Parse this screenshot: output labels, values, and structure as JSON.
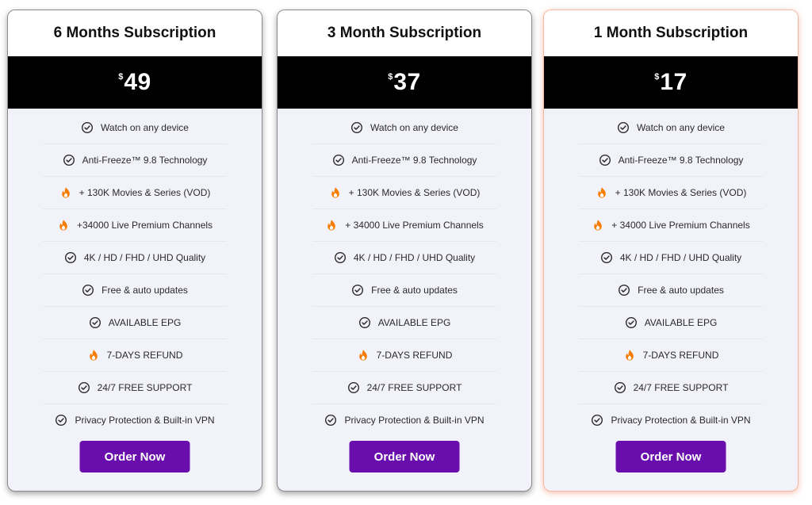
{
  "plans": [
    {
      "title": "6 Months Subscription",
      "currency": "$",
      "price": "49",
      "features": [
        {
          "icon": "check-circle-icon",
          "text": "Watch on any device"
        },
        {
          "icon": "check-circle-icon",
          "text": "Anti-Freeze™ 9.8 Technology"
        },
        {
          "icon": "fire-icon",
          "text": "+ 130K Movies & Series (VOD)"
        },
        {
          "icon": "fire-icon",
          "text": "+34000 Live Premium Channels"
        },
        {
          "icon": "check-circle-icon",
          "text": "4K / HD / FHD / UHD Quality"
        },
        {
          "icon": "check-circle-icon",
          "text": "Free & auto updates"
        },
        {
          "icon": "check-circle-icon",
          "text": "AVAILABLE EPG"
        },
        {
          "icon": "fire-icon",
          "text": "7-DAYS REFUND"
        },
        {
          "icon": "check-circle-icon",
          "text": "24/7 FREE SUPPORT"
        },
        {
          "icon": "check-circle-icon",
          "text": "Privacy Protection & Built-in VPN"
        }
      ],
      "button_label": "Order Now"
    },
    {
      "title": "3 Month Subscription",
      "currency": "$",
      "price": "37",
      "features": [
        {
          "icon": "check-circle-icon",
          "text": "Watch on any device"
        },
        {
          "icon": "check-circle-icon",
          "text": "Anti-Freeze™ 9.8 Technology"
        },
        {
          "icon": "fire-icon",
          "text": "+ 130K Movies & Series (VOD)"
        },
        {
          "icon": "fire-icon",
          "text": "+ 34000 Live Premium Channels"
        },
        {
          "icon": "check-circle-icon",
          "text": "4K / HD / FHD / UHD Quality"
        },
        {
          "icon": "check-circle-icon",
          "text": "Free & auto updates"
        },
        {
          "icon": "check-circle-icon",
          "text": "AVAILABLE EPG"
        },
        {
          "icon": "fire-icon",
          "text": "7-DAYS REFUND"
        },
        {
          "icon": "check-circle-icon",
          "text": "24/7 FREE SUPPORT"
        },
        {
          "icon": "check-circle-icon",
          "text": "Privacy Protection & Built-in VPN"
        }
      ],
      "button_label": "Order Now"
    },
    {
      "title": "1 Month Subscription",
      "currency": "$",
      "price": "17",
      "features": [
        {
          "icon": "check-circle-icon",
          "text": "Watch on any device"
        },
        {
          "icon": "check-circle-icon",
          "text": "Anti-Freeze™ 9.8 Technology"
        },
        {
          "icon": "fire-icon",
          "text": "+ 130K Movies & Series (VOD)"
        },
        {
          "icon": "fire-icon",
          "text": "+ 34000 Live Premium Channels"
        },
        {
          "icon": "check-circle-icon",
          "text": "4K / HD / FHD / UHD Quality"
        },
        {
          "icon": "check-circle-icon",
          "text": "Free & auto updates"
        },
        {
          "icon": "check-circle-icon",
          "text": "AVAILABLE EPG"
        },
        {
          "icon": "fire-icon",
          "text": "7-DAYS REFUND"
        },
        {
          "icon": "check-circle-icon",
          "text": "24/7 FREE SUPPORT"
        },
        {
          "icon": "check-circle-icon",
          "text": "Privacy Protection & Built-in VPN"
        }
      ],
      "button_label": "Order Now"
    }
  ],
  "colors": {
    "button": "#6a0dad",
    "price_band": "#000000",
    "card_bg": "#f2f2fb",
    "fire": "#f57c00",
    "highlight_border": "#f6b9a3"
  }
}
